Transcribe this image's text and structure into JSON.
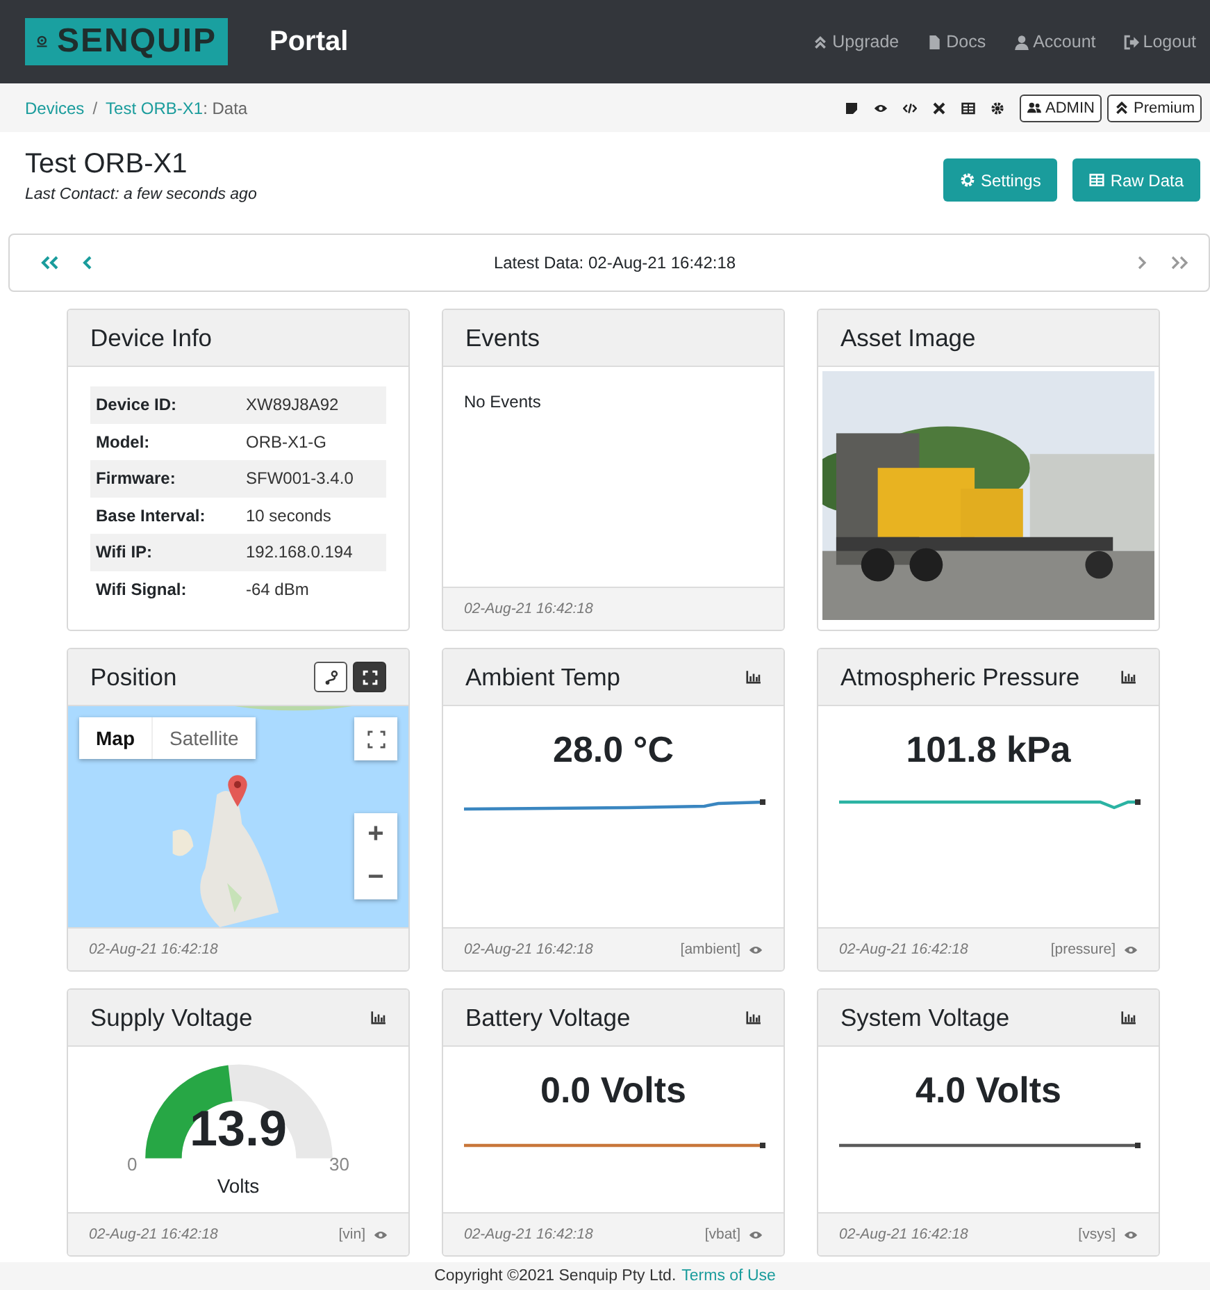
{
  "header": {
    "logo": "SENQUIP",
    "title": "Portal",
    "nav": [
      {
        "label": "Upgrade",
        "kind": "upgrade"
      },
      {
        "label": "Docs",
        "kind": "docs"
      },
      {
        "label": "Account",
        "kind": "account"
      },
      {
        "label": "Logout",
        "kind": "logout"
      }
    ]
  },
  "breadcrumb": {
    "items": [
      "Devices",
      "Test ORB-X1"
    ],
    "separator": "/",
    "current": ": Data",
    "buttons": [
      {
        "label": "ADMIN",
        "kind": "admin"
      },
      {
        "label": "Premium",
        "kind": "upgrade"
      }
    ]
  },
  "device": {
    "name": "Test ORB-X1",
    "last_contact": "Last Contact: a few seconds ago",
    "actions": [
      {
        "label": "Settings",
        "kind": "settings"
      },
      {
        "label": "Raw Data",
        "kind": "table"
      }
    ]
  },
  "pager": {
    "latest": "Latest Data: 02-Aug-21 16:42:18"
  },
  "cards": [
    {
      "kind": "info",
      "title": "Device Info",
      "rows": [
        {
          "label": "Device ID:",
          "value": "XW89J8A92"
        },
        {
          "label": "Model:",
          "value": "ORB-X1-G"
        },
        {
          "label": "Firmware:",
          "value": "SFW001-3.4.0"
        },
        {
          "label": "Base Interval:",
          "value": "10 seconds"
        },
        {
          "label": "Wifi IP:",
          "value": "192.168.0.194"
        },
        {
          "label": "Wifi Signal:",
          "value": "-64 dBm"
        }
      ]
    },
    {
      "kind": "events",
      "title": "Events",
      "message": "No Events",
      "time": "02-Aug-21 16:42:18"
    },
    {
      "title": "Asset Image"
    },
    {
      "kind": "map",
      "title": "Position",
      "map_types": [
        {
          "label": "Map",
          "selected": true
        },
        {
          "label": "Satellite",
          "selected": false
        }
      ],
      "zoom": [
        "+",
        "−"
      ],
      "time": "02-Aug-21 16:42:18"
    },
    {
      "kind": "reading",
      "title": "Ambient Temp",
      "value": "28.0 °C",
      "color": "#3a86c0",
      "time": "02-Aug-21 16:42:18",
      "tag": "[ambient]"
    },
    {
      "kind": "reading",
      "title": "Atmospheric Pressure",
      "value": "101.8 kPa",
      "color": "#2bb3a3",
      "time": "02-Aug-21 16:42:18",
      "tag": "[pressure]"
    },
    {
      "kind": "gauge",
      "title": "Supply Voltage",
      "value": "13.9",
      "min": "0",
      "max": "30",
      "unit": "Volts",
      "time": "02-Aug-21 16:42:18",
      "tag": "[vin]"
    },
    {
      "kind": "reading",
      "title": "Battery Voltage",
      "value": "0.0 Volts",
      "color": "#c8773a",
      "time": "02-Aug-21 16:42:18",
      "tag": "[vbat]"
    },
    {
      "kind": "reading",
      "title": "System Voltage",
      "value": "4.0 Volts",
      "color": "#5a5a5a",
      "time": "02-Aug-21 16:42:18",
      "tag": "[vsys]"
    }
  ],
  "footer": {
    "text": "Copyright ©2021 Senquip Pty Ltd.",
    "link": "Terms of Use"
  }
}
